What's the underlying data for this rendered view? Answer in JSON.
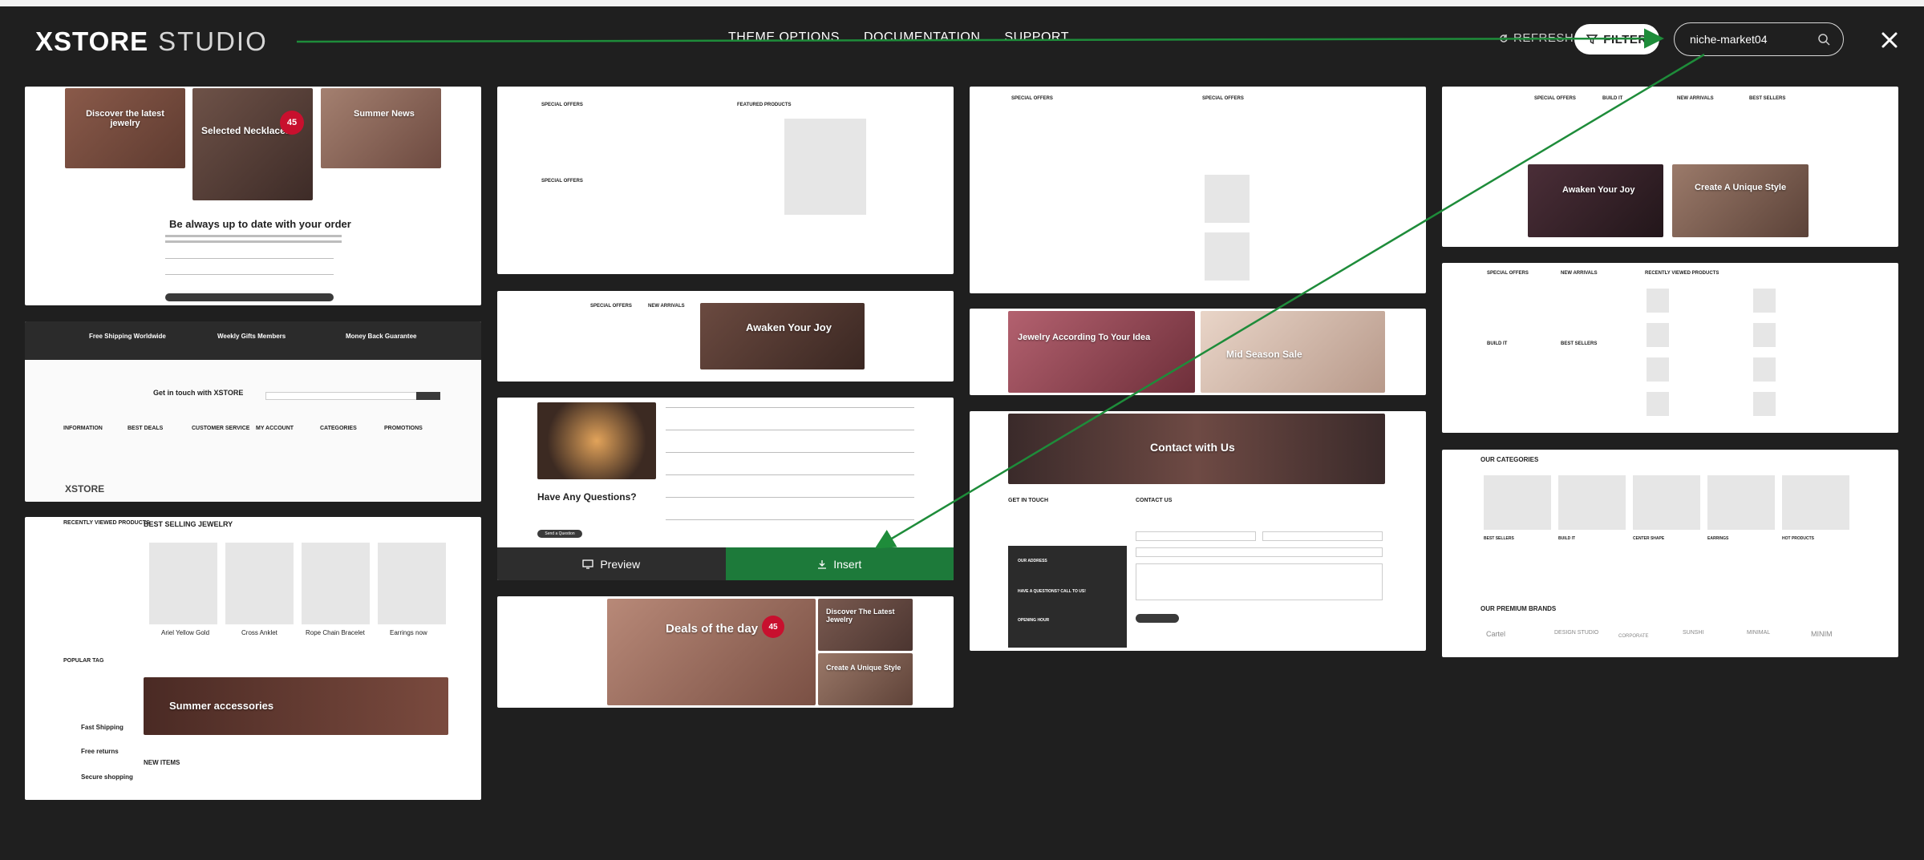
{
  "app": {
    "logo_mark": "XSTORE",
    "logo_sub": "STUDIO"
  },
  "nav": [
    {
      "label": "THEME OPTIONS"
    },
    {
      "label": "DOCUMENTATION"
    },
    {
      "label": "SUPPORT"
    }
  ],
  "toolbar": {
    "refresh_label": "REFRESH",
    "filter_label": "FILTER",
    "search_value": "niche-market04",
    "search_placeholder": "Search"
  },
  "colors": {
    "background": "#1f1f1f",
    "insert_green": "#1d7a3a",
    "preview_dark": "#2d2d2d",
    "annotation_arrow": "#1e8c3a"
  },
  "icons": [
    "refresh-icon",
    "filter-icon",
    "search-icon",
    "close-icon",
    "monitor-icon",
    "download-icon"
  ],
  "cards": {
    "c1": {
      "h1": "Discover the latest jewelry",
      "h2": "Selected Necklaces",
      "h3": "Summer News",
      "badge": "45",
      "title": "Be always up to date with your order"
    },
    "c2": {
      "features": [
        "Free Shipping Worldwide",
        "Weekly Gifts Members",
        "Money Back Guarantee"
      ],
      "contact": "Get in touch with XSTORE",
      "cols": [
        "INFORMATION",
        "BEST DEALS",
        "CUSTOMER SERVICE",
        "MY ACCOUNT",
        "CATEGORIES",
        "PROMOTIONS"
      ],
      "logo": "XSTORE"
    },
    "c3": {
      "sidebar_title": "RECENTLY VIEWED PRODUCTS",
      "main_title": "BEST SELLING JEWELRY",
      "products": [
        "Ariel Yellow Gold",
        "Cross Anklet",
        "Rope Chain Bracelet",
        "Earrings now"
      ],
      "banner": "Summer accessories",
      "tag_title": "POPULAR TAG",
      "perks": [
        "Fast Shipping",
        "Free returns",
        "Secure shopping"
      ],
      "new_items": "NEW ITEMS"
    },
    "c4": {
      "col1": "SPECIAL OFFERS",
      "col2": "FEATURED PRODUCTS",
      "col3": "SPECIAL OFFERS"
    },
    "c5": {
      "col1": "SPECIAL OFFERS",
      "col2": "NEW ARRIVALS",
      "banner": "Awaken Your Joy"
    },
    "c6": {
      "title": "Have Any Questions?",
      "button": "Send a Question"
    },
    "actions": {
      "preview": "Preview",
      "insert": "Insert"
    },
    "c7": {
      "title": "Deals of the day",
      "badge": "45",
      "side1": "Discover The Latest Jewelry",
      "side2": "Create A Unique Style"
    },
    "c8": {
      "col1": "SPECIAL OFFERS",
      "col2": "SPECIAL OFFERS"
    },
    "c9": {
      "left": "Jewelry According To Your Idea",
      "right": "Mid Season Sale"
    },
    "c10": {
      "banner": "Contact with Us",
      "git": "GET IN TOUCH",
      "contact": "CONTACT US",
      "address": "OUR ADDRESS",
      "call": "HAVE A QUESTIONS? CALL TO US!",
      "hours": "OPENING HOUR"
    },
    "c11": {
      "cols": [
        "SPECIAL OFFERS",
        "BUILD IT",
        "NEW ARRIVALS",
        "BEST SELLERS"
      ],
      "left": "Awaken Your Joy",
      "right": "Create A Unique Style"
    },
    "c12": {
      "cols": [
        "SPECIAL OFFERS",
        "NEW ARRIVALS",
        "RECENTLY VIEWED PRODUCTS"
      ],
      "sub": [
        "BUILD IT",
        "BEST SELLERS"
      ]
    },
    "c13": {
      "title": "OUR CATEGORIES",
      "cats": [
        "BEST SELLERS",
        "BUILD IT",
        "CENTER SHAPE",
        "EARRINGS",
        "HOT PRODUCTS"
      ],
      "brands_title": "OUR PREMIUM BRANDS",
      "brands": [
        "Cartel",
        "DESIGN STUDIO",
        "CORPORATE",
        "SUNSHI",
        "MINIMAL",
        "MINIM"
      ]
    }
  }
}
